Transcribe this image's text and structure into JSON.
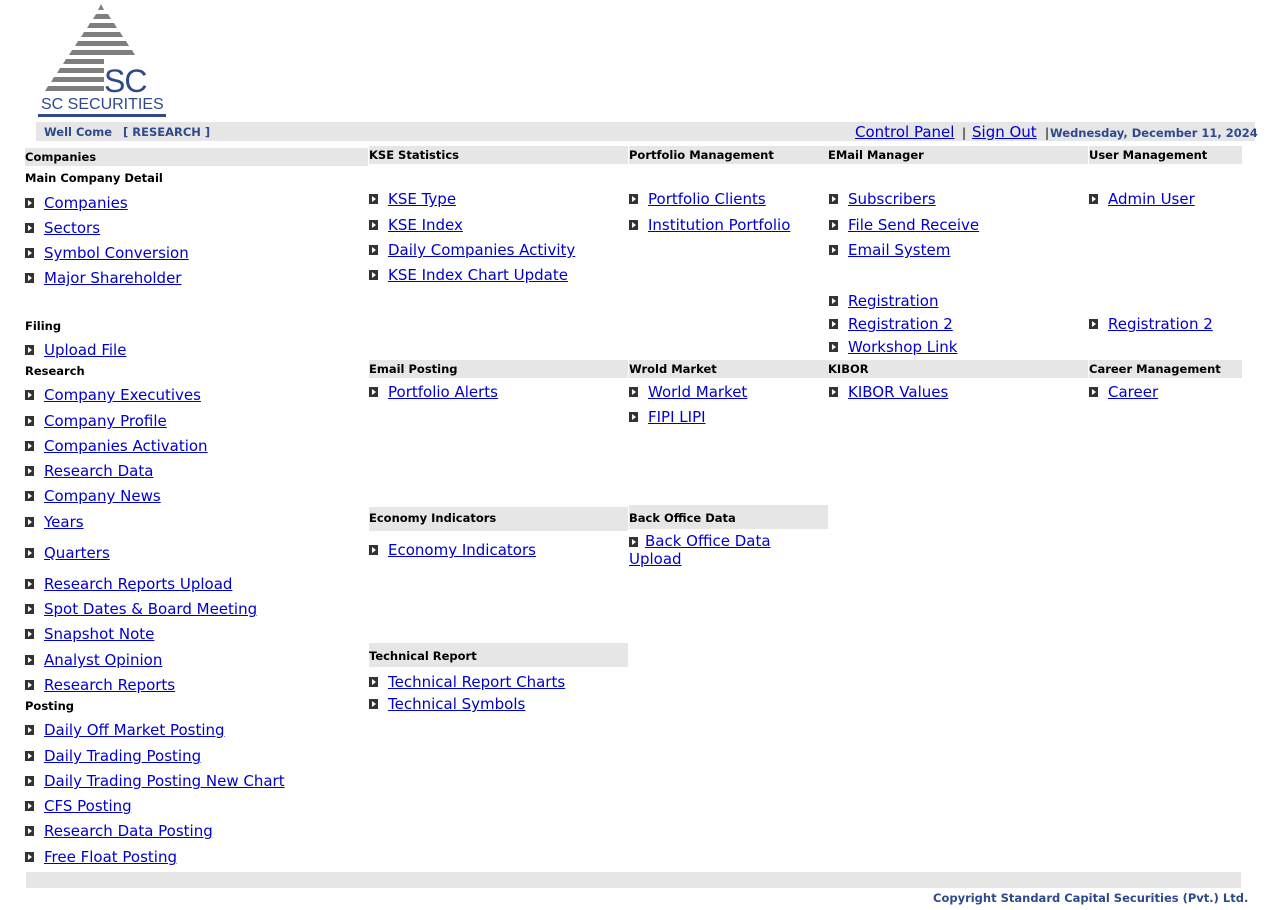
{
  "logo": {
    "initials": "SC",
    "name": "SC SECURITIES"
  },
  "topbar": {
    "welcome": "Well Come",
    "role": "[ RESEARCH ]",
    "control_panel": "Control Panel",
    "sep1": "|",
    "sign_out": "Sign Out",
    "sep2": "|",
    "date": "Wednesday, December 11, 2024"
  },
  "col1": {
    "companies_heading": "Companies",
    "main_detail_label": "Main Company Detail",
    "main_items": [
      "Companies",
      "Sectors",
      "Symbol Conversion",
      "Major Shareholder"
    ],
    "filing_label": "Filing",
    "filing_items": [
      "Upload File"
    ],
    "research_label": "Research",
    "research_items": [
      "Company Executives",
      "Company Profile",
      "Companies Activation",
      "Research Data",
      "Company News",
      "Years",
      "Quarters",
      "Research Reports Upload",
      "Spot Dates & Board Meeting",
      "Snapshot Note",
      "Analyst Opinion",
      "Research Reports"
    ],
    "posting_label": "Posting",
    "posting_items": [
      "Daily Off Market Posting",
      "Daily Trading Posting",
      "Daily Trading Posting New Chart",
      "CFS Posting",
      "Research Data Posting",
      "Free Float Posting"
    ]
  },
  "kse": {
    "heading": "KSE Statistics",
    "items": [
      "KSE Type",
      "KSE Index",
      "Daily Companies Activity",
      "KSE Index Chart Update"
    ]
  },
  "portfolio": {
    "heading": "Portfolio Management",
    "items": [
      "Portfolio Clients",
      "Institution Portfolio"
    ]
  },
  "email_manager": {
    "heading": "EMail Manager",
    "items": [
      "Subscribers",
      "File Send Receive",
      "Email System"
    ],
    "extra": [
      "Registration",
      "Registration 2",
      "Workshop Link"
    ]
  },
  "user_mgmt": {
    "heading": "User Management",
    "items": [
      "Admin User"
    ],
    "extra": [
      "Registration 2"
    ]
  },
  "email_posting": {
    "heading": "Email Posting",
    "items": [
      "Portfolio Alerts"
    ]
  },
  "world_market": {
    "heading": "Wrold Market",
    "items": [
      "World Market",
      "FIPI LIPI"
    ]
  },
  "kibor": {
    "heading": "KIBOR",
    "items": [
      "KIBOR Values"
    ]
  },
  "career": {
    "heading": "Career Management",
    "items": [
      "Career"
    ]
  },
  "economy": {
    "heading": "Economy Indicators",
    "items": [
      "Economy Indicators"
    ]
  },
  "back_office": {
    "heading": "Back Office Data",
    "items": [
      "Back Office Data Upload"
    ]
  },
  "technical": {
    "heading": "Technical Report",
    "items": [
      "Technical Report Charts",
      "Technical Symbols"
    ]
  },
  "footer": {
    "copyright": "Copyright Standard Capital Securities (Pvt.) Ltd."
  }
}
